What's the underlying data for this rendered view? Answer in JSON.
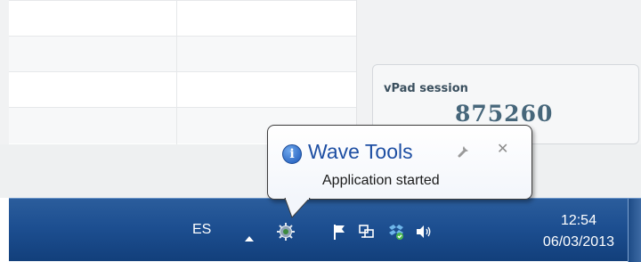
{
  "vpad": {
    "label": "vPad session",
    "value": "875260"
  },
  "balloon": {
    "title": "Wave Tools",
    "message": "Application started",
    "icon": "info-icon",
    "options_icon": "wrench-icon",
    "close_icon": "close-icon"
  },
  "taskbar": {
    "language": "ES",
    "time": "12:54",
    "date": "06/03/2013",
    "tray_icons": [
      "show-hidden-icons-arrow",
      "wave-tools-icon",
      "action-center-flag-icon",
      "network-icon",
      "dropbox-icon",
      "volume-icon"
    ]
  },
  "colors": {
    "taskbar": "#1d4f91",
    "balloon_title": "#1e4fa3",
    "vpad_value": "#46667a"
  }
}
